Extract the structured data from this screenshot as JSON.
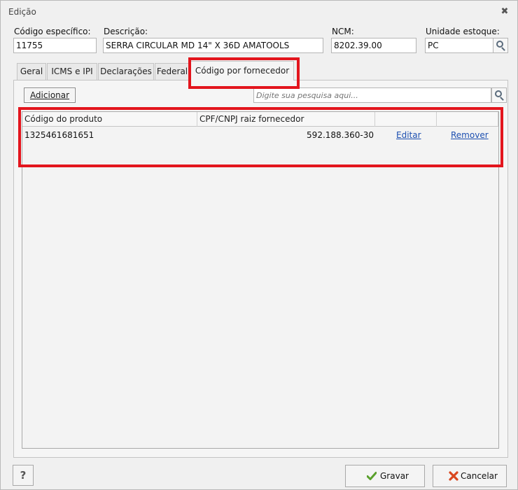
{
  "window": {
    "title": "Edição"
  },
  "fields": {
    "codigo_label": "Código específico:",
    "codigo_value": "11755",
    "descricao_label": "Descrição:",
    "descricao_value": "SERRA CIRCULAR MD 14\" X 36D AMATOOLS",
    "ncm_label": "NCM:",
    "ncm_value": "8202.39.00",
    "unidade_label": "Unidade estoque:",
    "unidade_value": "PC"
  },
  "tabs": [
    {
      "label": "Geral"
    },
    {
      "label": "ICMS e IPI"
    },
    {
      "label": "Declarações"
    },
    {
      "label": "Federal"
    },
    {
      "label": "Código por fornecedor",
      "active": true
    }
  ],
  "panel": {
    "add_label": "Adicionar",
    "search_placeholder": "Digite sua pesquisa aqui..."
  },
  "grid": {
    "columns": [
      "Código do produto",
      "CPF/CNPJ raiz fornecedor",
      "",
      ""
    ],
    "rows": [
      {
        "codigo": "1325461681651",
        "cnpj": "592.188.360-30",
        "edit": "Editar",
        "remove": "Remover"
      }
    ]
  },
  "footer": {
    "help_label": "?",
    "save_label": "Gravar",
    "cancel_label": "Cancelar"
  },
  "colors": {
    "highlight": "#e3151d",
    "link": "#1c4fb0",
    "save_icon": "#5aa02c",
    "cancel_icon": "#d9471f"
  },
  "icons": [
    "close-icon",
    "search-icon",
    "check-icon",
    "x-icon"
  ]
}
